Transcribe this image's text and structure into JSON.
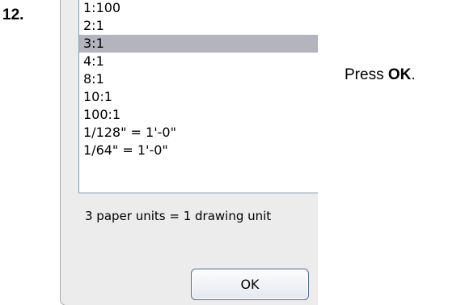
{
  "step": {
    "number": "12."
  },
  "dialog": {
    "scale_list": {
      "items": [
        "1:100",
        "2:1",
        "3:1",
        "4:1",
        "8:1",
        "10:1",
        "100:1",
        "1/128\" = 1'-0\"",
        "1/64\" = 1'-0\"",
        ""
      ],
      "selected_value": "3:1"
    },
    "summary": "3 paper units = 1 drawing unit",
    "ok_label": "OK",
    "colors": {
      "selection_highlight": "#b4b4be",
      "dialog_background": "#ececec",
      "button_border": "#4b6f9b"
    }
  },
  "instruction": {
    "prefix": "Press ",
    "action": "OK",
    "suffix": "."
  }
}
